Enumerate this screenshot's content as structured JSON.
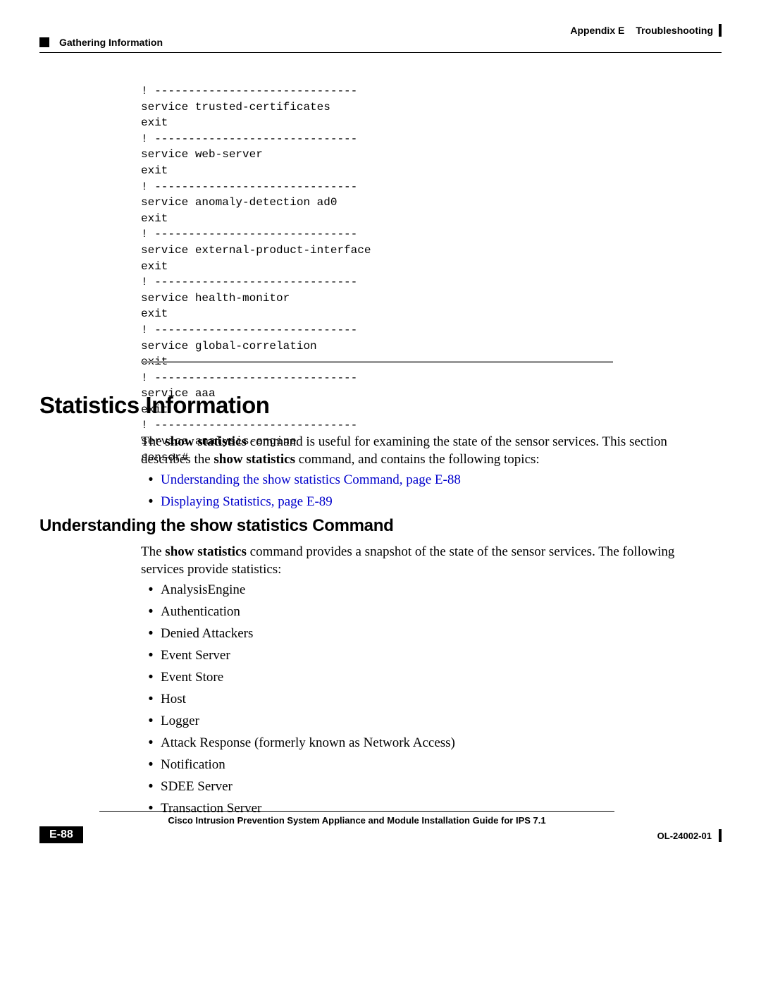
{
  "header": {
    "appendix_label": "Appendix E",
    "appendix_title": "Troubleshooting",
    "section_label": "Gathering Information"
  },
  "code": "! ------------------------------\nservice trusted-certificates\nexit\n! ------------------------------\nservice web-server\nexit\n! ------------------------------\nservice anomaly-detection ad0\nexit\n! ------------------------------\nservice external-product-interface\nexit\n! ------------------------------\nservice health-monitor\nexit\n! ------------------------------\nservice global-correlation\nexit\n! ------------------------------\nservice aaa\nexit\n! ------------------------------\nservice analysis-engine\nsensor#",
  "h1": "Statistics Information",
  "para1": {
    "pre": "The ",
    "bold1": "show statistics",
    "mid": " command is useful for examining the state of the sensor services. This section describes the ",
    "bold2": "show statistics",
    "post": " command, and contains the following topics:"
  },
  "toc": [
    "Understanding the show statistics Command, page E-88",
    "Displaying Statistics, page E-89"
  ],
  "h2": "Understanding the show statistics Command",
  "para2": {
    "pre": "The ",
    "bold1": "show statistics",
    "post": " command provides a snapshot of the state of the sensor services. The following services provide statistics:"
  },
  "services": [
    "AnalysisEngine",
    "Authentication",
    "Denied Attackers",
    "Event Server",
    "Event Store",
    "Host",
    "Logger",
    "Attack Response (formerly known as Network Access)",
    "Notification",
    "SDEE Server",
    "Transaction Server"
  ],
  "footer": {
    "title": "Cisco Intrusion Prevention System Appliance and Module Installation Guide for IPS 7.1",
    "page": "E-88",
    "docid": "OL-24002-01"
  }
}
